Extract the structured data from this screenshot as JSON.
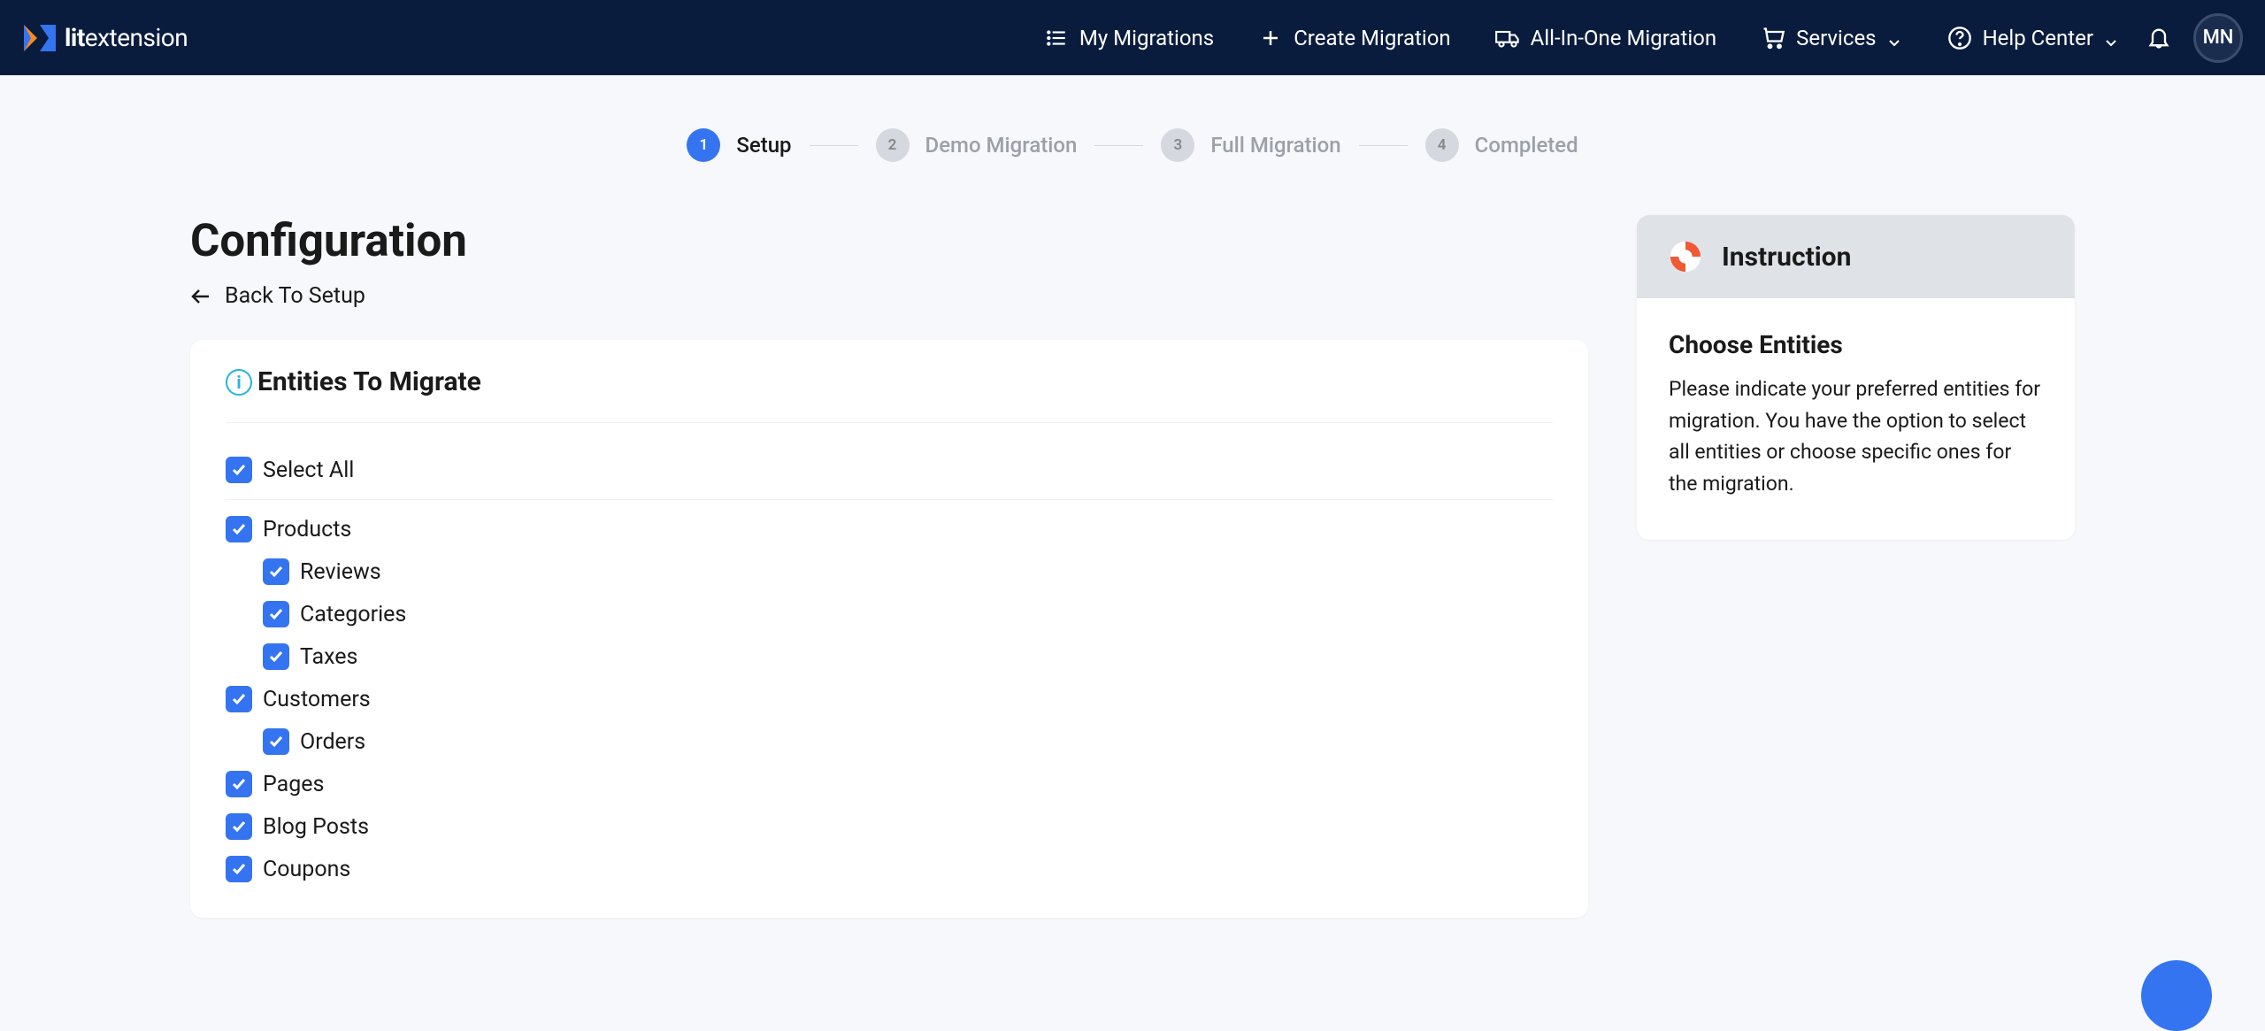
{
  "header": {
    "logo_text_lit": "lit",
    "logo_text_ext": "extension",
    "nav": {
      "my_migrations": "My Migrations",
      "create_migration": "Create Migration",
      "all_in_one": "All-In-One Migration",
      "services": "Services",
      "help_center": "Help Center"
    },
    "avatar_initials": "MN"
  },
  "stepper": {
    "steps": [
      {
        "num": "1",
        "label": "Setup",
        "active": true
      },
      {
        "num": "2",
        "label": "Demo Migration",
        "active": false
      },
      {
        "num": "3",
        "label": "Full Migration",
        "active": false
      },
      {
        "num": "4",
        "label": "Completed",
        "active": false
      }
    ]
  },
  "page": {
    "title": "Configuration",
    "back_label": "Back To Setup",
    "card_title": "Entities To Migrate"
  },
  "entities": {
    "select_all": "Select All",
    "products": "Products",
    "reviews": "Reviews",
    "categories": "Categories",
    "taxes": "Taxes",
    "customers": "Customers",
    "orders": "Orders",
    "pages": "Pages",
    "blog_posts": "Blog Posts",
    "coupons": "Coupons"
  },
  "instruction": {
    "title": "Instruction",
    "subtitle": "Choose Entities",
    "text": "Please indicate your preferred entities for migration. You have the option to select all entities or choose specific ones for the migration."
  },
  "colors": {
    "primary": "#3574f0",
    "header_bg": "#0a1c3e",
    "orange": "#f68b1f"
  }
}
